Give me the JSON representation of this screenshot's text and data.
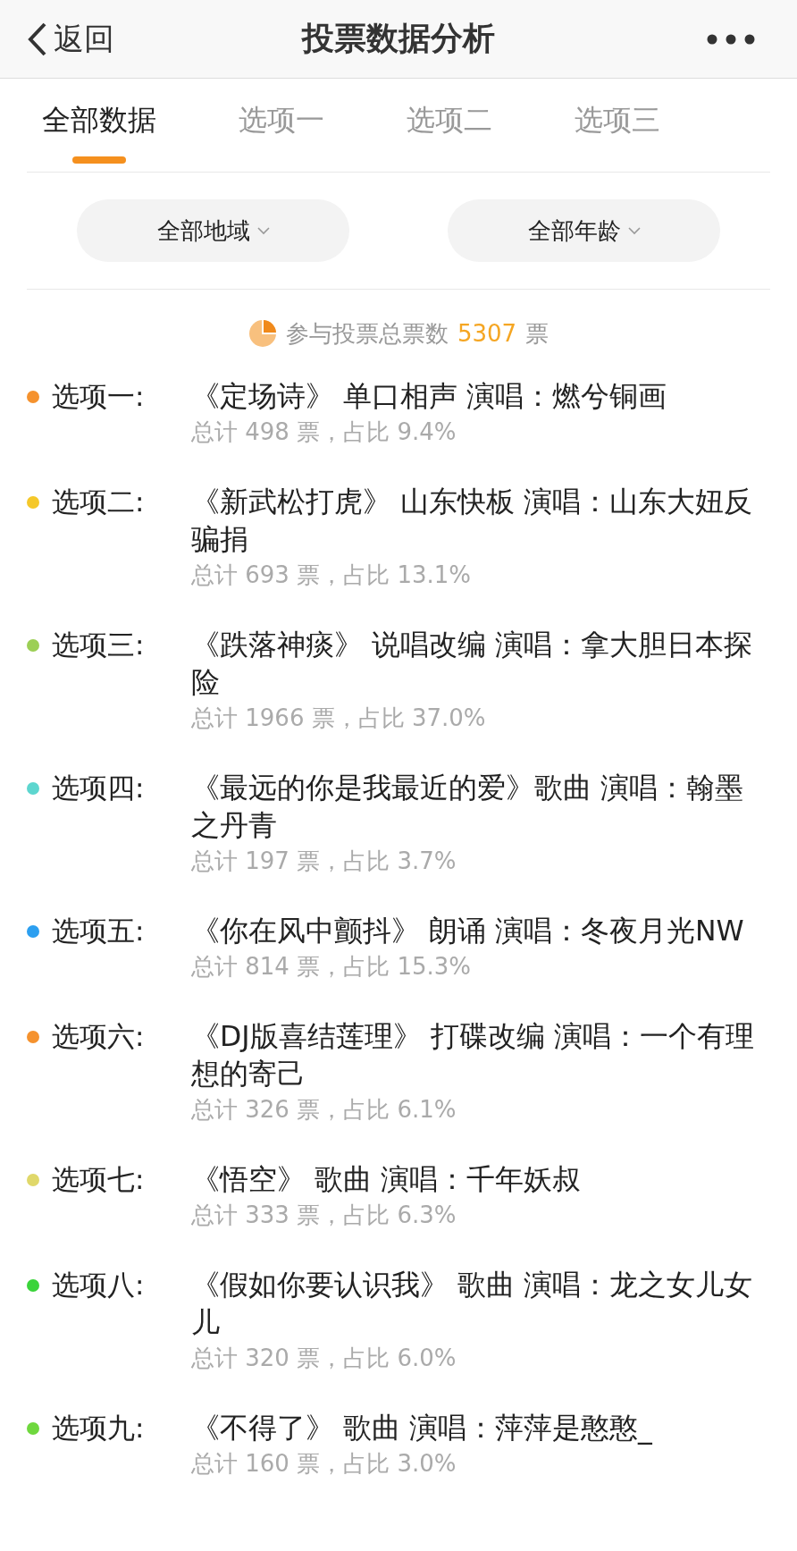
{
  "header": {
    "back_label": "返回",
    "title": "投票数据分析"
  },
  "tabs": [
    {
      "label": "全部数据",
      "selected": true
    },
    {
      "label": "选项一",
      "selected": false
    },
    {
      "label": "选项二",
      "selected": false
    },
    {
      "label": "选项三",
      "selected": false
    }
  ],
  "filters": [
    {
      "label": "全部地域"
    },
    {
      "label": "全部年龄"
    }
  ],
  "summary": {
    "label": "参与投票总票数",
    "total": "5307",
    "unit": "票"
  },
  "options": [
    {
      "label": "选项一:",
      "title": "《定场诗》 单口相声 演唱：燃兮铜画",
      "stats": "总计 498 票，占比 9.4%",
      "color": "#f5922e"
    },
    {
      "label": "选项二:",
      "title": "《新武松打虎》 山东快板 演唱：山东大妞反骗捐",
      "stats": "总计 693 票，占比 13.1%",
      "color": "#f5c82a"
    },
    {
      "label": "选项三:",
      "title": "《跌落神痰》 说唱改编 演唱：拿大胆日本探险",
      "stats": "总计 1966 票，占比 37.0%",
      "color": "#9ccf55"
    },
    {
      "label": "选项四:",
      "title": "《最远的你是我最近的爱》歌曲 演唱：翰墨之丹青",
      "stats": "总计 197 票，占比 3.7%",
      "color": "#5dd6cf"
    },
    {
      "label": "选项五:",
      "title": "《你在风中颤抖》 朗诵 演唱：冬夜月光NW",
      "stats": "总计 814 票，占比 15.3%",
      "color": "#2c9ff0"
    },
    {
      "label": "选项六:",
      "title": "《DJ版喜结莲理》 打碟改编 演唱：一个有理想的寄己",
      "stats": "总计 326 票，占比 6.1%",
      "color": "#f5922e"
    },
    {
      "label": "选项七:",
      "title": "《悟空》 歌曲 演唱：千年妖叔",
      "stats": "总计 333 票，占比 6.3%",
      "color": "#e0d86a"
    },
    {
      "label": "选项八:",
      "title": "《假如你要认识我》 歌曲 演唱：龙之女儿女儿",
      "stats": "总计 320 票，占比 6.0%",
      "color": "#3ad43a"
    },
    {
      "label": "选项九:",
      "title": "《不得了》 歌曲 演唱：萍萍是憨憨_",
      "stats": "总计 160 票，占比 3.0%",
      "color": "#6fd83e"
    }
  ]
}
